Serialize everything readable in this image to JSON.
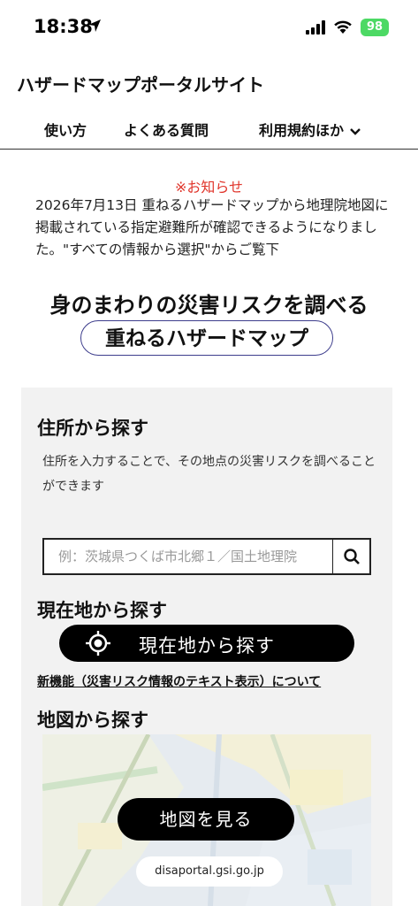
{
  "status_bar": {
    "time": "18:38",
    "battery": "98",
    "icons": [
      "location-arrow-icon",
      "cellular-signal-icon",
      "wifi-icon",
      "battery-icon"
    ]
  },
  "header": {
    "site_title": "ハザードマップポータルサイト",
    "nav": [
      {
        "label": "使い方"
      },
      {
        "label": "よくある質問"
      },
      {
        "label": "利用規約ほか"
      }
    ]
  },
  "notice": {
    "title": "※お知らせ",
    "body": "2026年7月13日 重ねるハザードマップから地理院地図に掲載されている指定避難所が確認できるようになりました。\"すべての情報から選択\"からご覧下"
  },
  "main": {
    "heading": "身のまわりの災害リスクを調べる",
    "subheading": "重ねるハザードマップ"
  },
  "address_search": {
    "title": "住所から探す",
    "description": "住所を入力することで、その地点の災害リスクを調べることができます",
    "placeholder": "例：茨城県つくば市北郷１／国土地理院",
    "value": ""
  },
  "current_location": {
    "title": "現在地から探す",
    "button_label": "現在地から探す",
    "new_feature_link": "新機能（災害リスク情報のテキスト表示）について"
  },
  "map_search": {
    "title": "地図から探す",
    "button_label": "地図を見る",
    "url_label": "disaportal.gsi.go.jp"
  },
  "colors": {
    "notice_red": "#e0352b",
    "button_black": "#000000",
    "panel_gray": "#f2f2f2",
    "subheading_border": "#3d3d8c",
    "battery_green": "#4cd964"
  }
}
